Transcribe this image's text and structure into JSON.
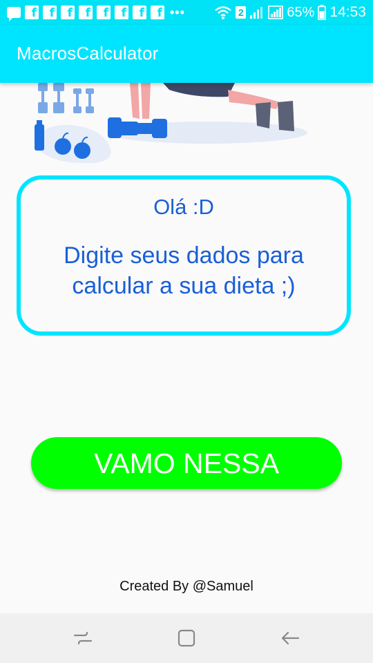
{
  "status_bar": {
    "badge": "2",
    "battery": "65%",
    "time": "14:53",
    "icons": [
      "chat-icon",
      "facebook-icon",
      "facebook-icon",
      "facebook-icon",
      "facebook-icon",
      "facebook-icon",
      "facebook-icon",
      "facebook-icon",
      "facebook-icon",
      "more-dots-icon",
      "wifi-icon",
      "signal-icon",
      "battery-icon"
    ]
  },
  "app_bar": {
    "title": "MacrosCalculator"
  },
  "card": {
    "greeting": "Olá :D",
    "message": "Digite seus dados para calcular a sua dieta ;)"
  },
  "start_button": {
    "label": "VAMO NESSA"
  },
  "footer": {
    "credits": "Created By @Samuel"
  },
  "nav_bar": {
    "icons": [
      "recent-apps-icon",
      "home-icon",
      "back-icon"
    ]
  },
  "colors": {
    "accent": "#00e5ff",
    "status_bar": "#00e2f5",
    "text_blue": "#1a5fd6",
    "button_green": "#00ff00",
    "background": "#fafafa"
  }
}
